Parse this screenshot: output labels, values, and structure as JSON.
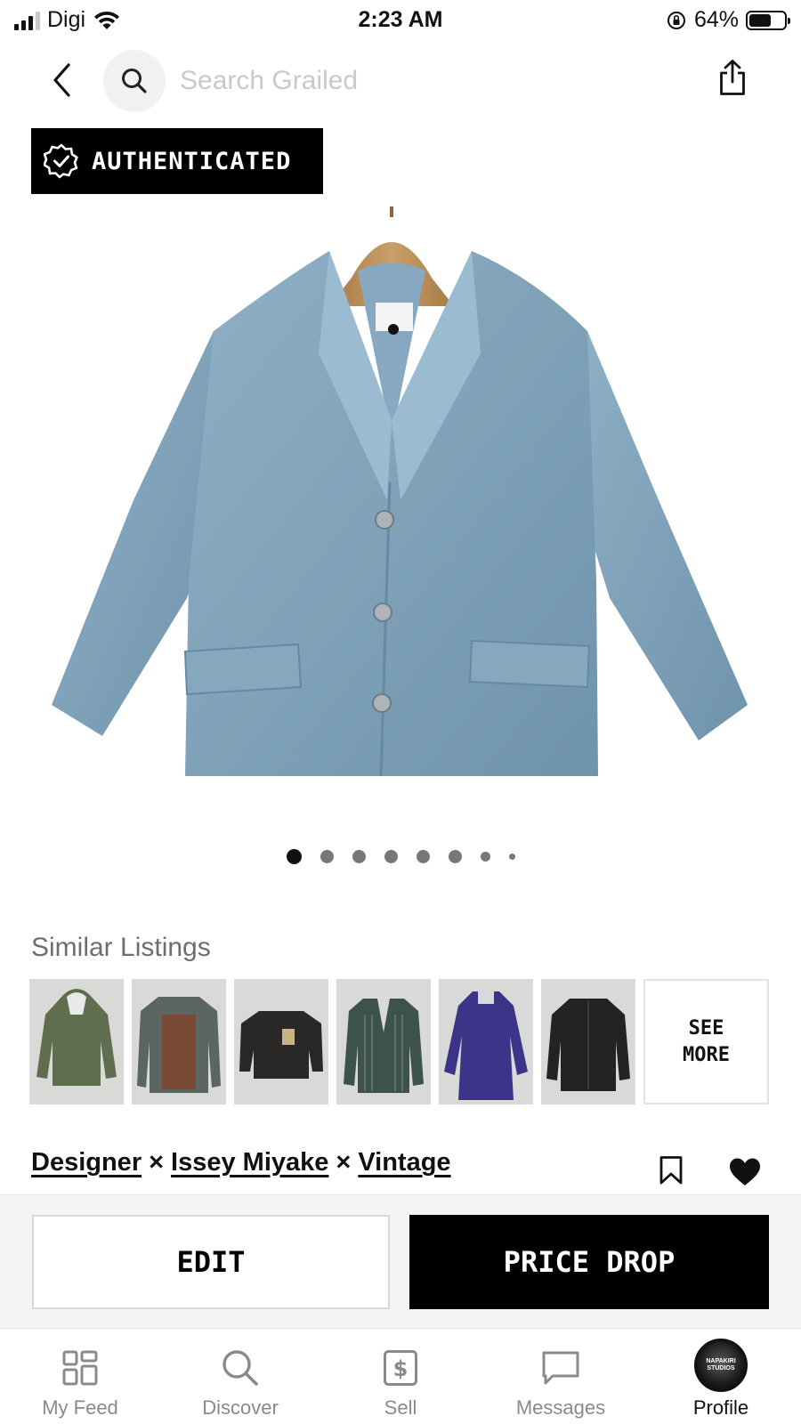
{
  "status_bar": {
    "carrier": "Digi",
    "time": "2:23 AM",
    "battery_percent": "64%",
    "battery_level": 0.64
  },
  "header": {
    "search_placeholder": "Search Grailed",
    "icons": [
      "back-chevron-icon",
      "search-icon",
      "share-icon"
    ]
  },
  "badge": {
    "label": "AUTHENTICATED",
    "icon": "verified-check-icon"
  },
  "gallery": {
    "image": "light blue linen shawl-collar jacket on wooden hanger",
    "image_count": 8,
    "active_index": 0
  },
  "similar": {
    "title": "Similar Listings",
    "items": [
      {
        "name": "olive hooded parka",
        "color": "#5f6e4e"
      },
      {
        "name": "brown and grey patchwork jacket",
        "color": "#7a4a34"
      },
      {
        "name": "black work jacket",
        "color": "#2a2826"
      },
      {
        "name": "green striped blazer",
        "color": "#3d5248"
      },
      {
        "name": "purple long coat",
        "color": "#3c3488"
      },
      {
        "name": "black shirt jacket",
        "color": "#232323"
      }
    ],
    "see_more": "SEE\nMORE"
  },
  "brands": {
    "items": [
      "Designer",
      "Issey Miyake",
      "Vintage"
    ],
    "separator": "×"
  },
  "actions": {
    "edit": "EDIT",
    "price_drop": "PRICE DROP"
  },
  "tabs": [
    {
      "label": "My Feed",
      "icon": "grid-feed-icon"
    },
    {
      "label": "Discover",
      "icon": "search-icon"
    },
    {
      "label": "Sell",
      "icon": "dollar-tag-icon"
    },
    {
      "label": "Messages",
      "icon": "chat-bubble-icon"
    },
    {
      "label": "Profile",
      "icon": "avatar",
      "avatar_text": "NAPAKIRI\nSTUDIOS",
      "active": true
    }
  ]
}
